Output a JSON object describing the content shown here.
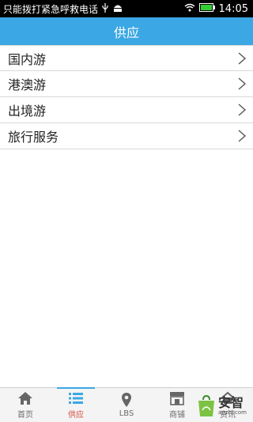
{
  "status_bar": {
    "carrier_text": "只能拨打紧急呼救电话",
    "time": "14:05"
  },
  "header": {
    "title": "供应"
  },
  "list": {
    "items": [
      {
        "label": "国内游"
      },
      {
        "label": "港澳游"
      },
      {
        "label": "出境游"
      },
      {
        "label": "旅行服务"
      }
    ]
  },
  "bottom_nav": {
    "items": [
      {
        "label": "首页",
        "icon": "home-icon"
      },
      {
        "label": "供应",
        "icon": "list-icon",
        "active": true
      },
      {
        "label": "LBS",
        "icon": "location-pin-icon"
      },
      {
        "label": "商铺",
        "icon": "shop-icon"
      },
      {
        "label": "资讯",
        "icon": "news-icon"
      }
    ]
  },
  "watermark": {
    "main": "安智",
    "sub": "anzhi.com"
  },
  "colors": {
    "accent": "#3ba7e4",
    "active_nav_text": "#d44a3a",
    "status_bar_bg": "#000000"
  }
}
